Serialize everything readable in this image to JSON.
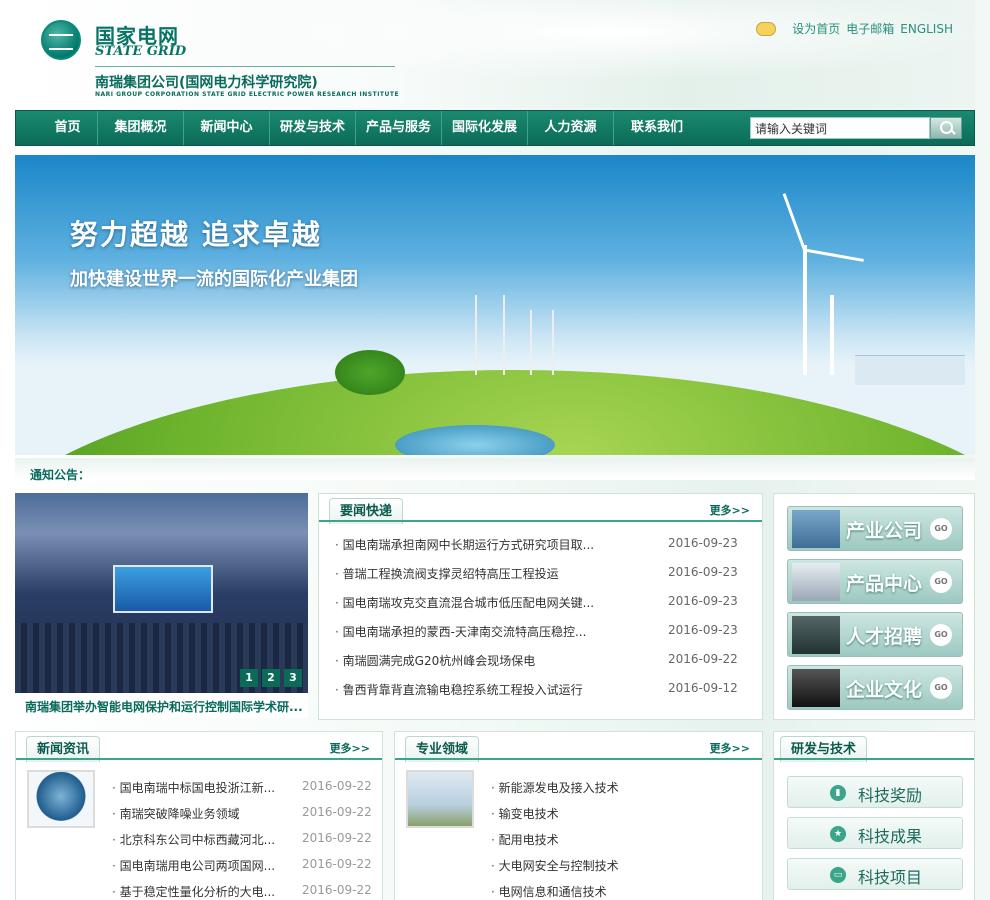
{
  "brand": {
    "name_cn": "国家电网",
    "name_en": "STATE GRID",
    "company_cn": "南瑞集团公司(国网电力科学研究院)",
    "company_en": "NARI GROUP CORPORATION   STATE GRID ELECTRIC POWER RESEARCH INSTITUTE"
  },
  "toplinks": {
    "set_home": "设为首页",
    "email": "电子邮箱",
    "english": "ENGLISH",
    "icon": "chat-bubble-icon"
  },
  "nav": [
    "首页",
    "集团概况",
    "新闻中心",
    "研发与技术",
    "产品与服务",
    "国际化发展",
    "人力资源",
    "联系我们"
  ],
  "search": {
    "placeholder": "请输入关键词",
    "icon": "search-icon"
  },
  "banner": {
    "headline": "努力超越   追求卓越",
    "subline": "加快建设世界一流的国际化产业集团"
  },
  "notice": {
    "label": "通知公告："
  },
  "photo": {
    "caption": "南瑞集团举办智能电网保护和运行控制国际学术研...",
    "pages": [
      "1",
      "2",
      "3"
    ]
  },
  "news_flash": {
    "title": "要闻快递",
    "more": "更多>>",
    "items": [
      {
        "title": "国电南瑞承担南网中长期运行方式研究项目取...",
        "date": "2016-09-23"
      },
      {
        "title": "普瑞工程换流阀支撑灵绍特高压工程投运",
        "date": "2016-09-23"
      },
      {
        "title": "国电南瑞攻克交直流混合城市低压配电网关键...",
        "date": "2016-09-23"
      },
      {
        "title": "国电南瑞承担的蒙西-天津南交流特高压稳控...",
        "date": "2016-09-23"
      },
      {
        "title": "南瑞圆满完成G20杭州峰会现场保电",
        "date": "2016-09-22"
      },
      {
        "title": "鲁西背靠背直流输电稳控系统工程投入试运行",
        "date": "2016-09-12"
      }
    ]
  },
  "side": [
    {
      "label": "产业公司",
      "go": "GO",
      "icon": "power-tower-icon"
    },
    {
      "label": "产品中心",
      "go": "GO",
      "icon": "meter-device-icon"
    },
    {
      "label": "人才招聘",
      "go": "GO",
      "icon": "graduation-cap-icon"
    },
    {
      "label": "企业文化",
      "go": "GO",
      "icon": "camera-icon"
    }
  ],
  "news_info": {
    "title": "新闻资讯",
    "more": "更多>>",
    "items": [
      {
        "title": "国电南瑞中标国电投浙江新...",
        "date": "2016-09-22"
      },
      {
        "title": "南瑞突破降噪业务领域",
        "date": "2016-09-22"
      },
      {
        "title": "北京科东公司中标西藏河北...",
        "date": "2016-09-22"
      },
      {
        "title": "国电南瑞用电公司两项国网...",
        "date": "2016-09-22"
      },
      {
        "title": "基于稳定性量化分析的大电...",
        "date": "2016-09-22"
      }
    ]
  },
  "fields": {
    "title": "专业领域",
    "more": "更多>>",
    "items": [
      "新能源发电及接入技术",
      "输变电技术",
      "配用电技术",
      "大电网安全与控制技术",
      "电网信息和通信技术"
    ]
  },
  "rd": {
    "title": "研发与技术",
    "items": [
      {
        "label": "科技奖励",
        "icon": "award-icon"
      },
      {
        "label": "科技成果",
        "icon": "star-icon"
      },
      {
        "label": "科技项目",
        "icon": "monitor-icon"
      }
    ]
  },
  "colors": {
    "brand_green": "#0b6b57",
    "accent_teal": "#3aa58b",
    "sky_blue": "#1b87c8",
    "grass_green": "#6db32c"
  }
}
